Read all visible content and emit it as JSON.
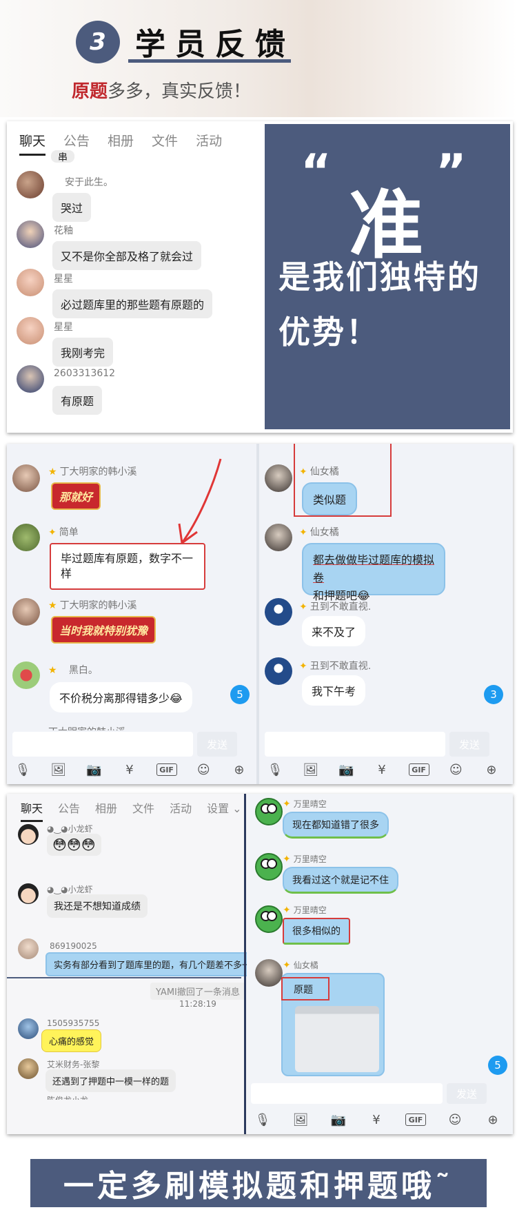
{
  "header": {
    "number": "3",
    "title": "学员反馈",
    "subtitle_highlight": "原题",
    "subtitle_rest": "多多，真实反馈！"
  },
  "panel1": {
    "tabs": [
      "聊天",
      "公告",
      "相册",
      "文件",
      "活动"
    ],
    "cut_top": "串",
    "messages": [
      {
        "name": "安于此生。",
        "text": "哭过"
      },
      {
        "name": "花釉",
        "text": "又不是你全部及格了就会过"
      },
      {
        "name": "星星",
        "text": "必过题库里的那些题有原题的"
      },
      {
        "name": "星星",
        "text": "我刚考完"
      },
      {
        "name": "2603313612",
        "text": "有原题"
      }
    ],
    "promo": {
      "open_quote": "“",
      "big": "准",
      "close_quote": "”",
      "line1": "是我们独特的",
      "line2": "优势！"
    }
  },
  "panel2": {
    "left": [
      {
        "name": "丁大明家的韩小溪",
        "sticker": "那就好"
      },
      {
        "name": "简单",
        "text": "毕过题库有原题，数字不一样"
      },
      {
        "name": "丁大明家的韩小溪",
        "sticker": "当时我就特别犹豫"
      },
      {
        "name": "黑白。",
        "text": "不价税分离那得错多少😂"
      }
    ],
    "left_cut": "丁大明家的韩小溪",
    "right": [
      {
        "name": "仙女橘",
        "text": "类似题"
      },
      {
        "name": "仙女橘",
        "text": "都去做做毕过题库的模拟卷",
        "text2": "和押题吧😂"
      },
      {
        "name": "丑到不敢直视.",
        "text": "来不及了"
      },
      {
        "name": "丑到不敢直视.",
        "text": "我下午考"
      }
    ],
    "send": "发送",
    "count_left": "5",
    "count_right": "3",
    "tools": [
      "mic-icon",
      "image-icon",
      "camera-icon",
      "redpacket-icon",
      "gif-icon",
      "emoji-icon",
      "plus-icon"
    ]
  },
  "panel3": {
    "tabs": [
      "聊天",
      "公告",
      "相册",
      "文件",
      "活动",
      "设置 ⌄"
    ],
    "left": [
      {
        "name": "◕‿◕小龙虾",
        "text": "😳😳😳"
      },
      {
        "name": "◕‿◕小龙虾",
        "text": "我还是不想知道成绩"
      },
      {
        "name": "869190025",
        "text": "实务有部分看到了题库里的题，有几个题差不多一样的"
      },
      {
        "name": "1505935755",
        "text": "心痛的感觉"
      },
      {
        "name": "艾米财务-张黎",
        "text": "还遇到了押题中一模一样的题"
      }
    ],
    "recall": "YAMI撤回了一条消息",
    "time": "11:28:19",
    "left_cut": "陈俊龙小龙",
    "right": [
      {
        "name": "万里晴空",
        "text": "现在都知道错了很多"
      },
      {
        "name": "万里晴空",
        "text": "我看过这个就是记不住"
      },
      {
        "name": "万里晴空",
        "text": "很多相似的"
      },
      {
        "name": "仙女橘",
        "text": "原题"
      }
    ],
    "send": "发送",
    "count": "5"
  },
  "banner": {
    "text": "一定多刷模拟题和押题哦˜"
  },
  "colors": {
    "navy": "#4c5b7d",
    "red": "#c0282d",
    "bubble_blue": "#a8d4f2"
  }
}
